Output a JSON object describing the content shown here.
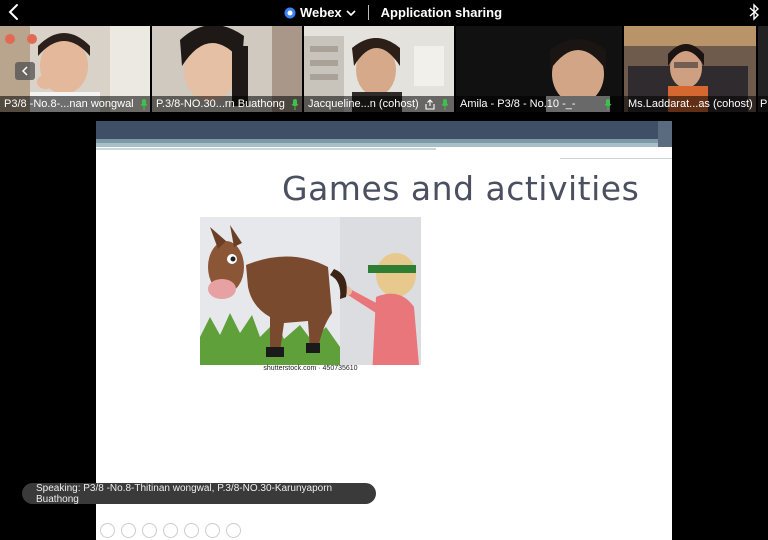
{
  "topbar": {
    "app_name": "Webex",
    "mode_label": "Application sharing"
  },
  "participants": [
    {
      "name": "P3/8 -No.8-...nan wongwal",
      "mic": "on"
    },
    {
      "name": "P.3/8-NO.30...rn Buathong",
      "mic": "on"
    },
    {
      "name": "Jacqueline...n (cohost)",
      "mic": "on",
      "sharing": true
    },
    {
      "name": "Amila - P3/8 - No.10 -_-",
      "mic": "on"
    },
    {
      "name": "Ms.Laddarat...as (cohost)",
      "mic": "muted"
    },
    {
      "name": "P",
      "mic": "on"
    }
  ],
  "slide": {
    "title": "Games and activities",
    "image_caption": "shutterstock.com · 450735610"
  },
  "speaking": {
    "text": "Speaking: P3/8 -No.8-Thitinan wongwal, P.3/8-NO.30-Karunyaporn Buathong"
  },
  "colors": {
    "mic_on": "#3cc24a",
    "mic_muted": "#e0443a",
    "slide_header": "#3f4f66",
    "title_text": "#4a5060"
  }
}
